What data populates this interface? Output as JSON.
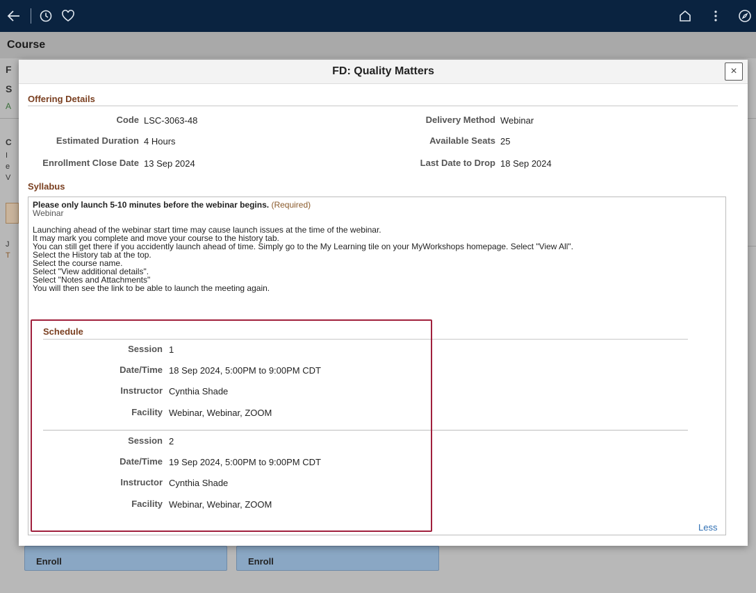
{
  "topbar": {
    "icons": [
      "back-arrow-icon",
      "history-icon",
      "favorite-heart-icon",
      "home-icon",
      "more-vertical-icon",
      "compass-icon"
    ]
  },
  "page": {
    "title": "Course",
    "fragments": [
      "F",
      "S",
      "A",
      "C",
      "I",
      "e",
      "V",
      "J",
      "T"
    ],
    "enroll_buttons": [
      "Enroll",
      "Enroll"
    ]
  },
  "modal": {
    "title": "FD: Quality Matters",
    "close_symbol": "×",
    "offering": {
      "section_title": "Offering Details",
      "left": [
        {
          "label": "Code",
          "value": "LSC-3063-48"
        },
        {
          "label": "Estimated Duration",
          "value": "4 Hours"
        },
        {
          "label": "Enrollment Close Date",
          "value": "13 Sep 2024"
        }
      ],
      "right": [
        {
          "label": "Delivery Method",
          "value": "Webinar"
        },
        {
          "label": "Available Seats",
          "value": "25"
        },
        {
          "label": "Last Date to Drop",
          "value": "18 Sep 2024"
        }
      ]
    },
    "syllabus": {
      "section_title": "Syllabus",
      "heading": "Please only launch 5-10 minutes before the webinar begins.",
      "required": "(Required)",
      "type": "Webinar",
      "lines": [
        "Launching ahead of the webinar start time may cause launch issues at the time of the webinar.",
        "It may mark you complete and move your course to the history tab.",
        "You can still get there if you accidently launch ahead of time. Simply go to the My Learning tile on your MyWorkshops homepage. Select \"View All\".",
        "Select the History tab at the top.",
        "Select the course name.",
        "Select \"View additional details\".",
        "Select \"Notes and Attachments\"",
        "You will then see the link to be able to launch the meeting again."
      ]
    },
    "schedule": {
      "section_title": "Schedule",
      "sessions": [
        {
          "session": "1",
          "datetime": "18 Sep 2024, 5:00PM to 9:00PM CDT",
          "instructor": "Cynthia Shade",
          "facility": "Webinar, Webinar, ZOOM"
        },
        {
          "session": "2",
          "datetime": "19 Sep 2024, 5:00PM to 9:00PM CDT",
          "instructor": "Cynthia Shade",
          "facility": "Webinar, Webinar, ZOOM"
        }
      ],
      "labels": {
        "session": "Session",
        "datetime": "Date/Time",
        "instructor": "Instructor",
        "facility": "Facility"
      }
    },
    "less_link": "Less"
  },
  "colors": {
    "topbar": "#0a2340",
    "section_title": "#7a3f20",
    "highlight_border": "#a0203c",
    "link": "#2f6fb3"
  }
}
